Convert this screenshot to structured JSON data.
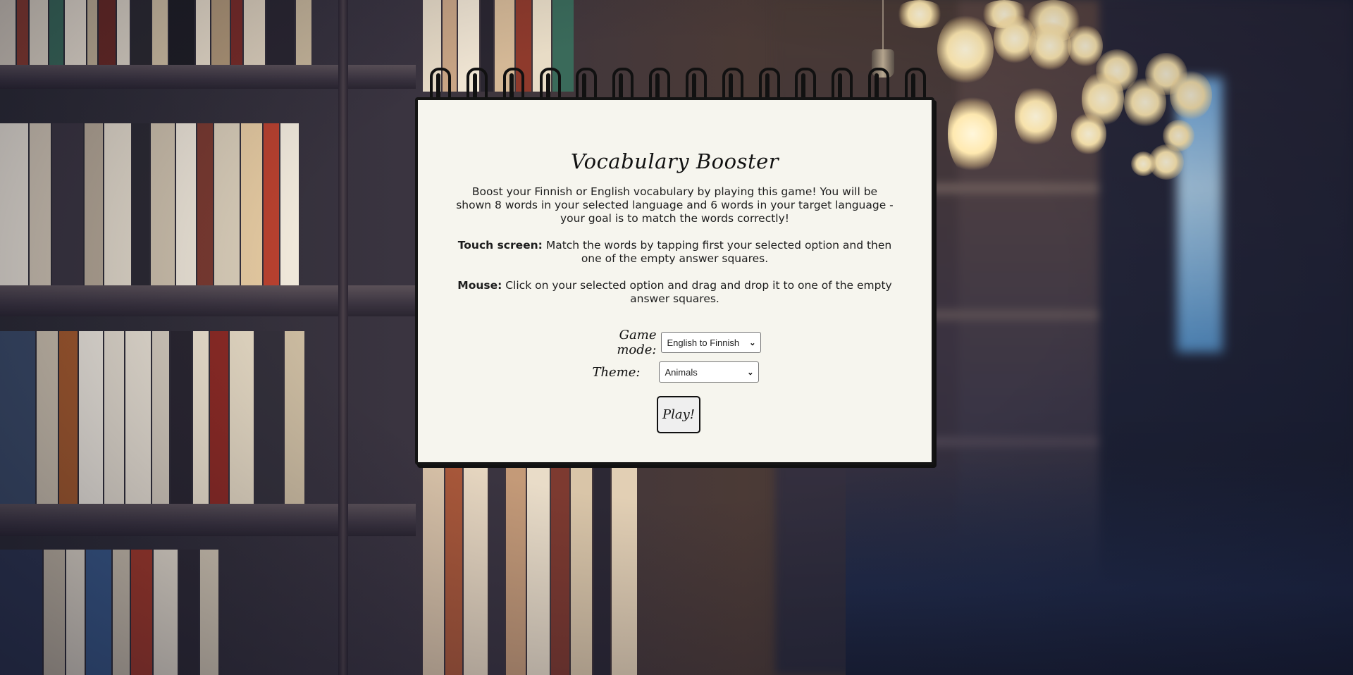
{
  "app": {
    "title": "Vocabulary Booster"
  },
  "instructions": {
    "intro": "Boost your Finnish or English vocabulary by playing this game! You will be shown 8 words in your selected language and 6 words in your target language - your goal is to match the words correctly!",
    "touch_label": "Touch screen:",
    "touch_text": " Match the words by tapping first your selected option and then one of the empty answer squares.",
    "mouse_label": "Mouse:",
    "mouse_text": " Click on your selected option and drag and drop it to one of the empty answer squares."
  },
  "form": {
    "game_mode_label": "Game mode:",
    "game_mode_value": "English to Finnish",
    "theme_label": "Theme:",
    "theme_value": "Animals",
    "play_label": "Play!"
  },
  "icons": {
    "dropdown": "chevron-down-icon",
    "binding": "spiral-ring-icon"
  },
  "colors": {
    "paper": "#f6f5ee",
    "ink": "#111111",
    "button_bg": "#efefef"
  }
}
